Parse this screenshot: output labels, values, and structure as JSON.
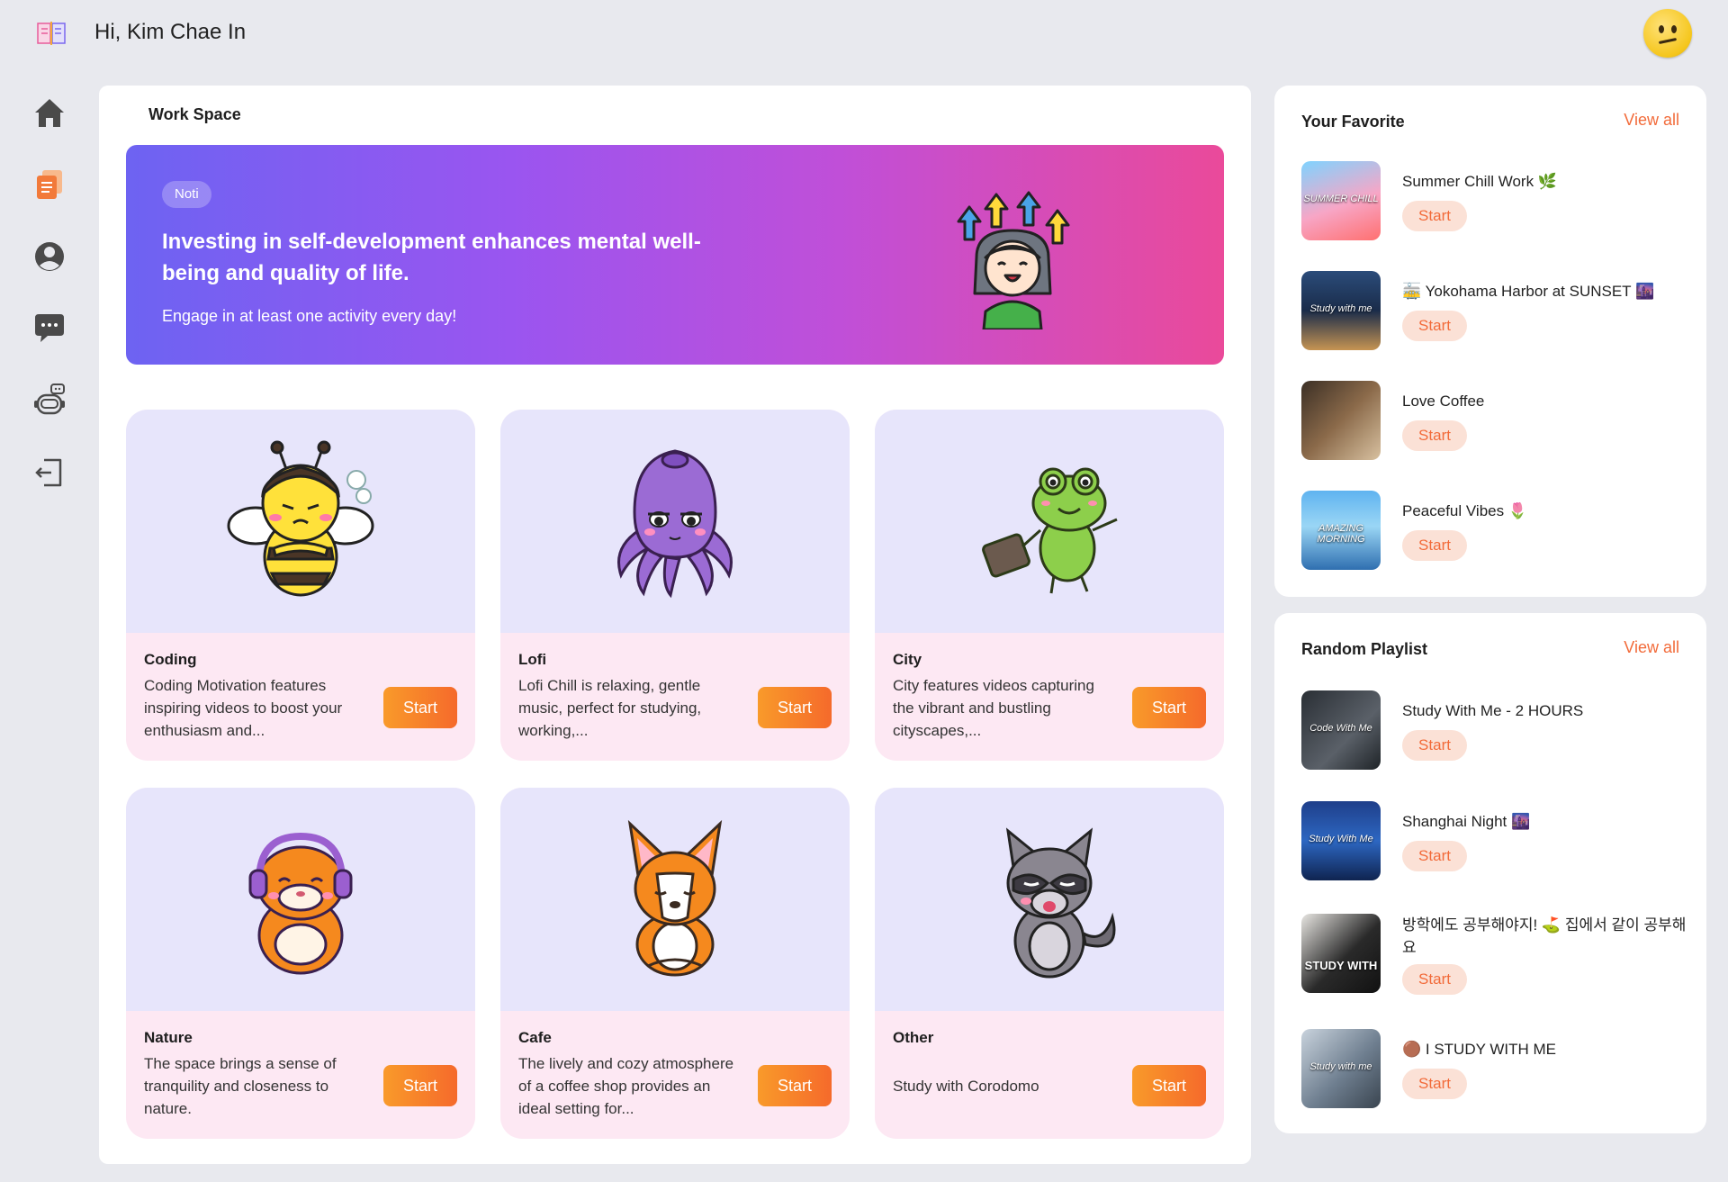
{
  "header": {
    "greeting": "Hi, Kim Chae In"
  },
  "sidebar": {
    "items": [
      "home-icon",
      "notebook-icon",
      "profile-icon",
      "chat-icon",
      "robot-icon",
      "logout-icon"
    ]
  },
  "workspace": {
    "title": "Work Space",
    "banner": {
      "pill": "Noti",
      "headline": "Investing in self-development enhances mental well-being and quality of life.",
      "subtext": "Engage in at least one activity every day!"
    },
    "cards": [
      {
        "title": "Coding",
        "description": "Coding Motivation features inspiring videos to boost your enthusiasm and...",
        "button": "Start"
      },
      {
        "title": "Lofi",
        "description": "Lofi Chill is relaxing, gentle music, perfect for studying, working,...",
        "button": "Start"
      },
      {
        "title": "City",
        "description": "City features videos capturing the vibrant and bustling cityscapes,...",
        "button": "Start"
      },
      {
        "title": "Nature",
        "description": "The space brings a sense of tranquility and closeness to nature.",
        "button": "Start"
      },
      {
        "title": "Cafe",
        "description": "The lively and cozy atmosphere of a coffee shop provides an ideal setting for...",
        "button": "Start"
      },
      {
        "title": "Other",
        "description": "Study with Corodomo",
        "button": "Start"
      }
    ]
  },
  "favorites": {
    "title": "Your Favorite",
    "view_all": "View all",
    "items": [
      {
        "name": "Summer Chill Work 🌿",
        "button": "Start",
        "thumb_caption": "SUMMER CHILL"
      },
      {
        "name": "🚋 Yokohama Harbor at SUNSET 🌆",
        "button": "Start",
        "thumb_caption": "Study with me"
      },
      {
        "name": "Love Coffee",
        "button": "Start",
        "thumb_caption": ""
      },
      {
        "name": "Peaceful Vibes 🌷",
        "button": "Start",
        "thumb_caption": "AMAZING MORNING"
      }
    ]
  },
  "random_playlist": {
    "title": "Random Playlist",
    "view_all": "View all",
    "items": [
      {
        "name": "Study With Me - 2 HOURS",
        "button": "Start",
        "thumb_caption": "Code With Me"
      },
      {
        "name": "Shanghai Night 🌆",
        "button": "Start",
        "thumb_caption": "Study With Me"
      },
      {
        "name": "방학에도 공부해야지! ⛳ 집에서 같이 공부해요",
        "button": "Start",
        "thumb_caption": "STUDY WITH"
      },
      {
        "name": "🟤 I STUDY WITH ME",
        "button": "Start",
        "thumb_caption": "Study with me"
      }
    ]
  }
}
